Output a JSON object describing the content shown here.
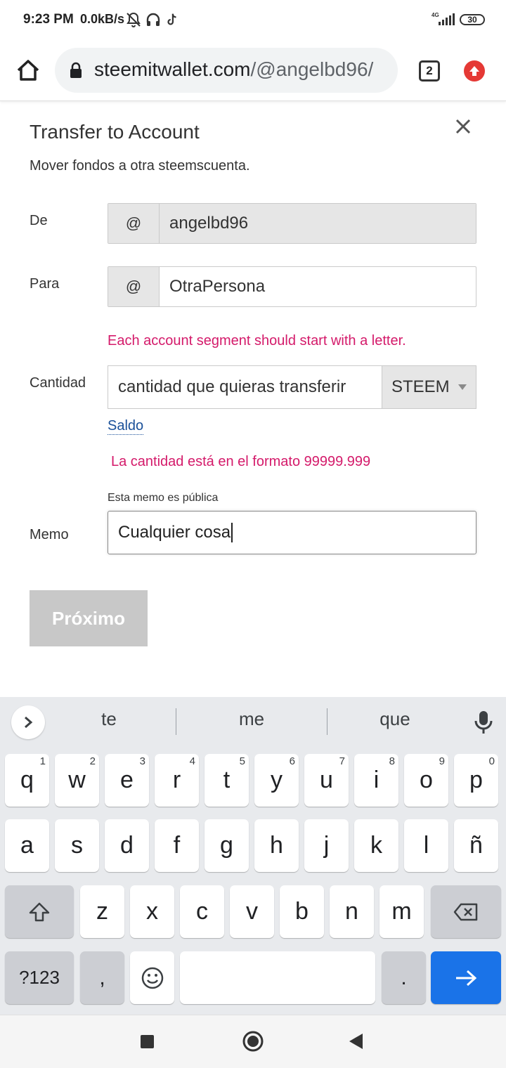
{
  "status_bar": {
    "time": "9:23 PM",
    "speed": "0.0kB/s",
    "network": "4G",
    "battery": "30"
  },
  "browser": {
    "url_host": "steemitwallet.com",
    "url_path": "/@angelbd96/",
    "tab_count": "2"
  },
  "dialog": {
    "title": "Transfer to Account",
    "subtitle": "Mover fondos a otra steemscuenta.",
    "from_label": "De",
    "from_prefix": "@",
    "from_value": "angelbd96",
    "to_label": "Para",
    "to_prefix": "@",
    "to_value": "OtraPersona",
    "to_error": "Each account segment should start with a letter.",
    "amount_label": "Cantidad",
    "amount_value": "cantidad que quieras transferir",
    "currency": "STEEM",
    "balance_link": "Saldo",
    "amount_error": "La cantidad está en el formato 99999.999",
    "memo_hint": "Esta memo es pública",
    "memo_label": "Memo",
    "memo_value": "Cualquier cosa",
    "next_button": "Próximo"
  },
  "keyboard": {
    "suggestions": [
      "te",
      "me",
      "que"
    ],
    "row1": [
      {
        "k": "q",
        "h": "1"
      },
      {
        "k": "w",
        "h": "2"
      },
      {
        "k": "e",
        "h": "3"
      },
      {
        "k": "r",
        "h": "4"
      },
      {
        "k": "t",
        "h": "5"
      },
      {
        "k": "y",
        "h": "6"
      },
      {
        "k": "u",
        "h": "7"
      },
      {
        "k": "i",
        "h": "8"
      },
      {
        "k": "o",
        "h": "9"
      },
      {
        "k": "p",
        "h": "0"
      }
    ],
    "row2": [
      "a",
      "s",
      "d",
      "f",
      "g",
      "h",
      "j",
      "k",
      "l",
      "ñ"
    ],
    "row3": [
      "z",
      "x",
      "c",
      "v",
      "b",
      "n",
      "m"
    ],
    "symbols_key": "?123",
    "comma_key": ",",
    "period_key": "."
  },
  "colors": {
    "error": "#d41a6a",
    "link": "#1a5099",
    "enter_key": "#1a73e8",
    "update_badge": "#e53935"
  }
}
